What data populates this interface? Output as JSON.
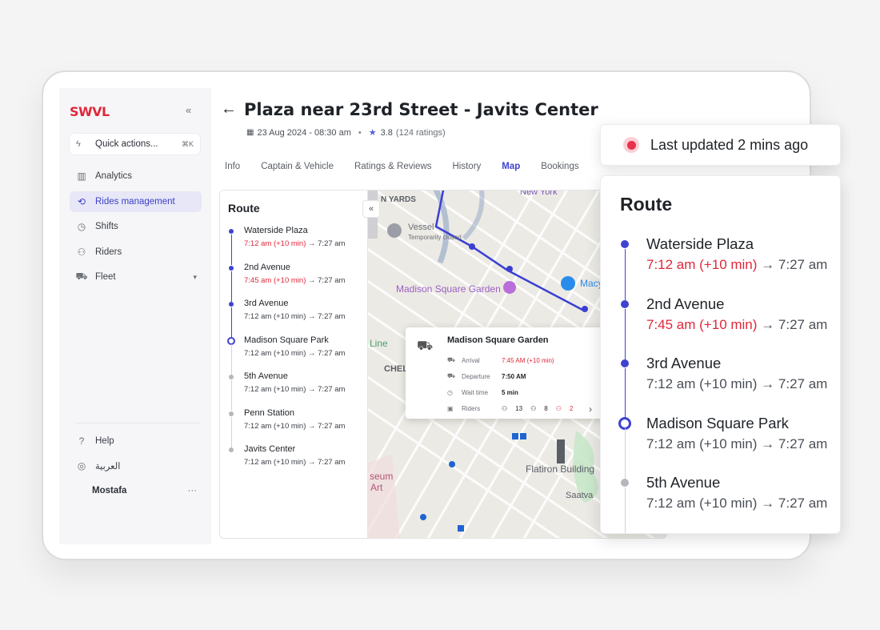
{
  "brand": {
    "logo": "SWVL",
    "accent": "#4043d0",
    "alert": "#e0273a"
  },
  "sidebar": {
    "quick_actions": {
      "label": "Quick actions...",
      "shortcut": "⌘K"
    },
    "items": [
      {
        "label": "Analytics",
        "icon": "analytics-icon"
      },
      {
        "label": "Rides management",
        "icon": "route-icon",
        "active": true
      },
      {
        "label": "Shifts",
        "icon": "clock-icon"
      },
      {
        "label": "Riders",
        "icon": "users-icon"
      },
      {
        "label": "Fleet",
        "icon": "car-icon"
      }
    ],
    "bottom": [
      {
        "label": "Help",
        "icon": "help-icon"
      },
      {
        "label": "العربية",
        "icon": "globe-icon"
      }
    ],
    "user": {
      "name": "Mostafa",
      "menu": "···"
    }
  },
  "header": {
    "title": "Plaza near 23rd Street - Javits Center",
    "date": "23 Aug 2024 - 08:30 am",
    "rating": "3.8",
    "ratings_count": "(124 ratings)"
  },
  "tabs": [
    "Info",
    "Captain & Vehicle",
    "Ratings & Reviews",
    "History",
    "Map",
    "Bookings"
  ],
  "active_tab": "Map",
  "route": {
    "title": "Route",
    "stops": [
      {
        "name": "Waterside Plaza",
        "eta": "7:12 am (+10 min)",
        "arrow": "→",
        "sched": "7:27 am",
        "late": true,
        "status": "done"
      },
      {
        "name": "2nd Avenue",
        "eta": "7:45 am (+10 min)",
        "arrow": "→",
        "sched": "7:27 am",
        "late": true,
        "status": "done"
      },
      {
        "name": "3rd Avenue",
        "eta": "7:12 am (+10 min)",
        "arrow": "→",
        "sched": "7:27 am",
        "late": false,
        "status": "done"
      },
      {
        "name": "Madison Square Park",
        "eta": "7:12 am (+10 min)",
        "arrow": "→",
        "sched": "7:27 am",
        "late": false,
        "status": "current"
      },
      {
        "name": "5th Avenue",
        "eta": "7:12 am (+10 min)",
        "arrow": "→",
        "sched": "7:27 am",
        "late": false,
        "status": "upcoming"
      },
      {
        "name": "Penn Station",
        "eta": "7:12 am (+10 min)",
        "arrow": "→",
        "sched": "7:27 am",
        "late": false,
        "status": "upcoming"
      },
      {
        "name": "Javits Center",
        "eta": "7:12 am (+10 min)",
        "arrow": "→",
        "sched": "7:27 am",
        "late": false,
        "status": "upcoming"
      }
    ]
  },
  "map": {
    "labels": {
      "yards": "N YARDS",
      "new_york": "New York",
      "vessel": "Vessel",
      "vessel_sub": "Temporarily closed",
      "msg": "Madison Square Garden",
      "macy": "Macy",
      "line": "Line",
      "chel": "CHEL",
      "flatiron": "Flatiron Building",
      "saatva": "Saatva",
      "museum": "seum",
      "art": "Art"
    },
    "popup": {
      "title": "Madison Square Garden",
      "arrival_label": "Arrival",
      "arrival_value": "7:45 AM (+10 min)",
      "departure_label": "Departure",
      "departure_value": "7:50 AM",
      "wait_label": "Wait time",
      "wait_value": "5 min",
      "riders_label": "Riders",
      "riders_board": "13",
      "riders_drop": "8",
      "riders_noshow": "2",
      "more": "›"
    }
  },
  "last_updated": "Last updated 2 mins ago"
}
